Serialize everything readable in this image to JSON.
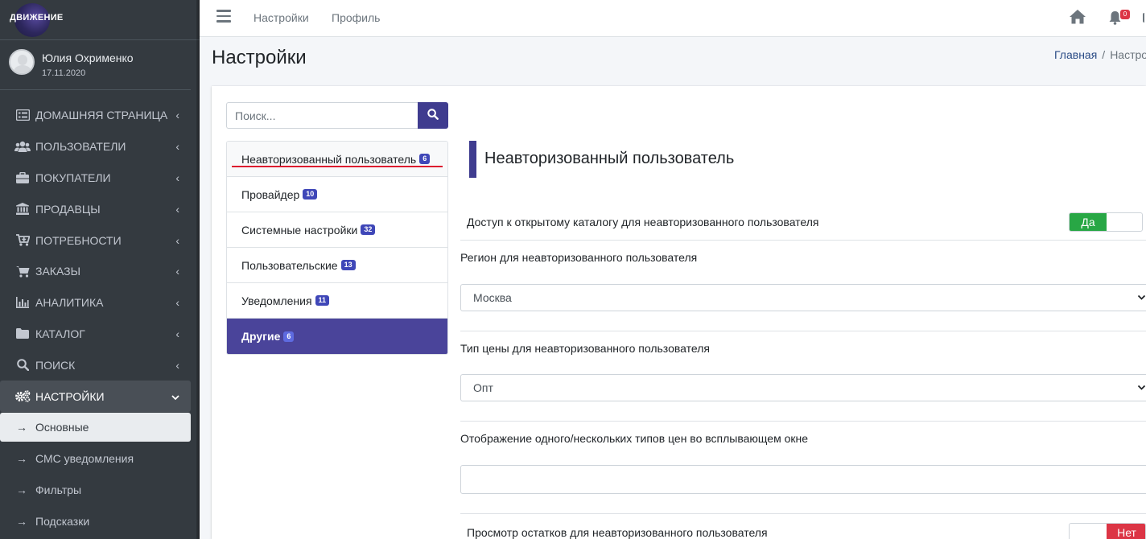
{
  "brand": {
    "name": "ДВИЖЕНИЕ"
  },
  "user": {
    "name": "Юлия Охрименко",
    "date": "17.11.2020"
  },
  "sidebar": {
    "items": [
      {
        "label": "ДОМАШНЯЯ СТРАНИЦА",
        "icon": "list-icon"
      },
      {
        "label": "ПОЛЬЗОВАТЕЛИ",
        "icon": "users-icon"
      },
      {
        "label": "ПОКУПАТЕЛИ",
        "icon": "briefcase-icon"
      },
      {
        "label": "ПРОДАВЦЫ",
        "icon": "bank-icon"
      },
      {
        "label": "ПОТРЕБНОСТИ",
        "icon": "cart-plus-icon"
      },
      {
        "label": "ЗАКАЗЫ",
        "icon": "cart-icon"
      },
      {
        "label": "АНАЛИТИКА",
        "icon": "chart-icon"
      },
      {
        "label": "КАТАЛОГ",
        "icon": "folder-icon"
      },
      {
        "label": "ПОИСК",
        "icon": "search-icon"
      },
      {
        "label": "НАСТРОЙКИ",
        "icon": "gears-icon"
      }
    ],
    "sub_items": [
      {
        "label": "Основные"
      },
      {
        "label": "СМС уведомления"
      },
      {
        "label": "Фильтры"
      },
      {
        "label": "Подсказки"
      }
    ]
  },
  "topbar": {
    "links": [
      "Настройки",
      "Профиль"
    ],
    "notifications_count": "0"
  },
  "page": {
    "title": "Настройки",
    "breadcrumb": {
      "home": "Главная",
      "separator": "/",
      "current": "Настро"
    }
  },
  "search": {
    "placeholder": "Поиск..."
  },
  "categories": [
    {
      "label": "Неавторизованный пользователь",
      "count": "6"
    },
    {
      "label": "Провайдер",
      "count": "10"
    },
    {
      "label": "Системные настройки",
      "count": "32"
    },
    {
      "label": "Пользовательские",
      "count": "13"
    },
    {
      "label": "Уведомления",
      "count": "11"
    },
    {
      "label": "Другие",
      "count": "6"
    }
  ],
  "settings": {
    "section_title": "Неавторизованный пользователь",
    "catalog_access": {
      "label": "Доступ к открытому каталогу для неавторизованного пользователя",
      "value": "Да"
    },
    "region": {
      "label": "Регион для неавторизованного пользователя",
      "value": "Москва"
    },
    "price_type": {
      "label": "Тип цены для неавторизованного пользователя",
      "value": "Опт"
    },
    "price_popup": {
      "label": "Отображение одного/нескольких типов цен во всплывающем окне",
      "value": ""
    },
    "stock_view": {
      "label": "Просмотр остатков для неавторизованного пользователя",
      "value": "Нет"
    }
  },
  "colors": {
    "sidebar": "#343a40",
    "accent": "#3f3c8f",
    "active_category": "#4a449a",
    "badge": "#3f47b8",
    "toggle_on": "#28a745",
    "toggle_off": "#dc3545",
    "underline": "#dc1c2e"
  }
}
